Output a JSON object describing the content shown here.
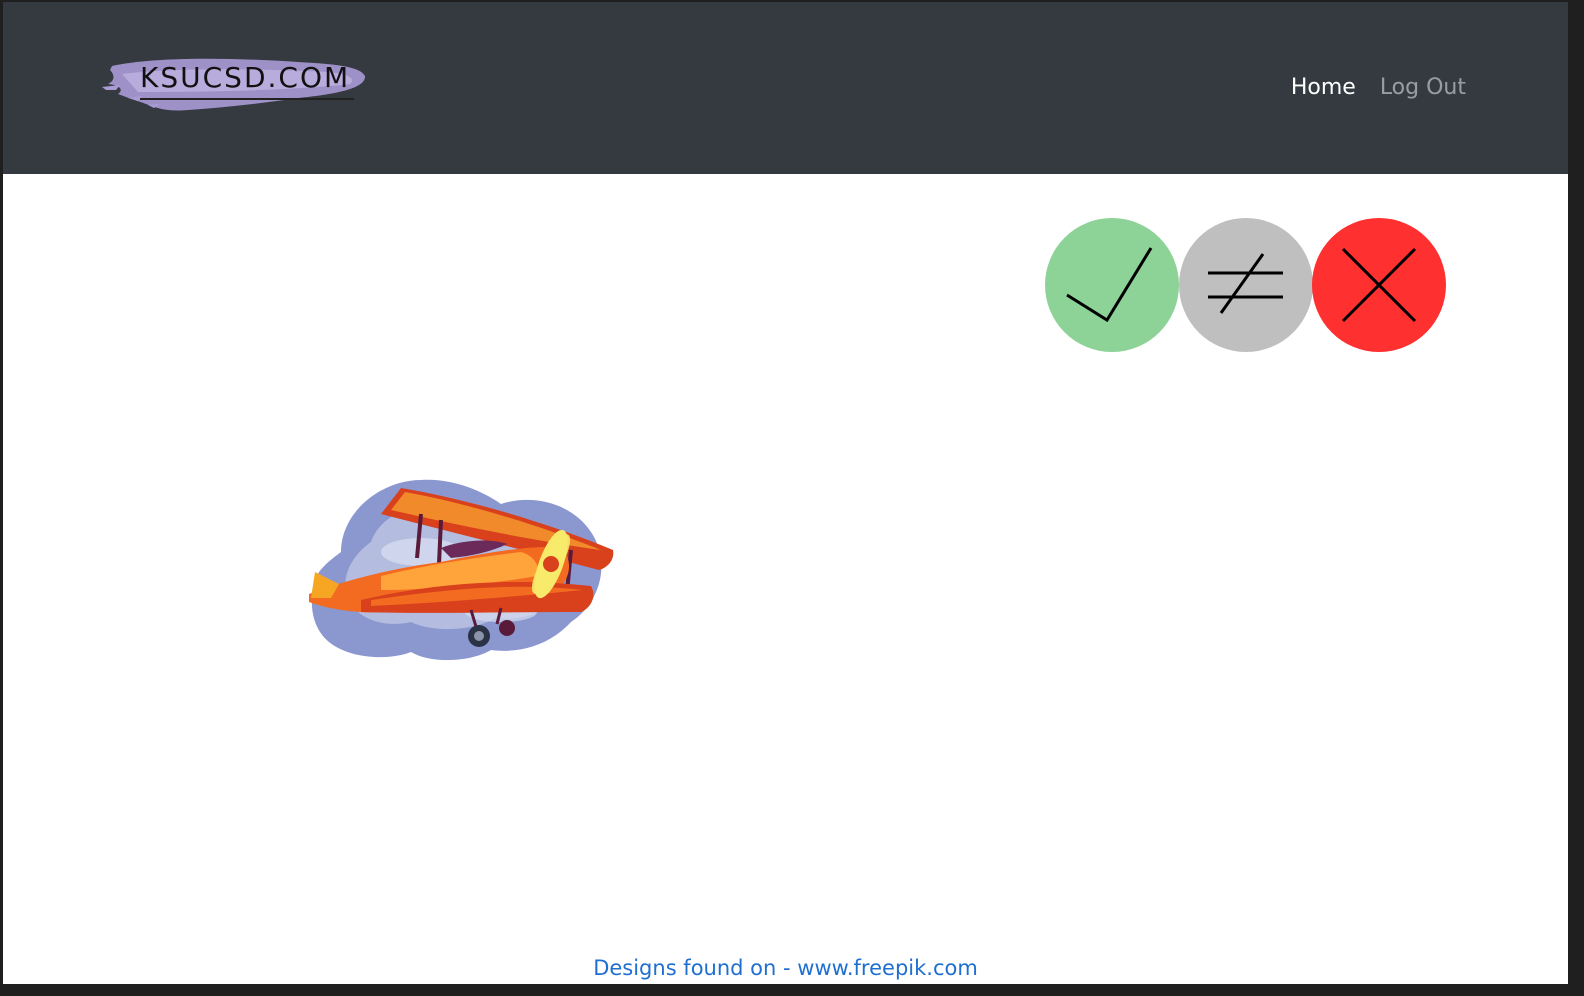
{
  "navbar": {
    "brand_text": "KSUCSD.COM",
    "links": [
      {
        "label": "Home",
        "state": "active"
      },
      {
        "label": "Log Out",
        "state": "inactive"
      }
    ]
  },
  "actions": [
    {
      "icon": "check-icon",
      "color": "#8dd398"
    },
    {
      "icon": "not-equal-icon",
      "color": "#bfbfbf"
    },
    {
      "icon": "close-icon",
      "color": "#ff3030"
    }
  ],
  "image": {
    "icon": "biplane-cloud-illustration"
  },
  "footer": {
    "prefix": "Designs found on - ",
    "link_text": "www.freepik.com"
  },
  "colors": {
    "navbar_bg": "#343a40",
    "link_blue": "#1f6fd1",
    "brand_swash": "#a99bd6"
  }
}
